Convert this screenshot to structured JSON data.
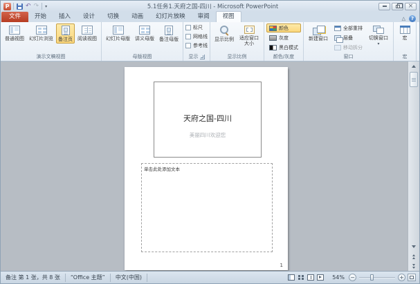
{
  "colors": {
    "highlight_fill": "#fbd77d",
    "highlight_border": "#c79f42",
    "file_tab": "#b63c22",
    "doc_background": "#b7bdc4"
  },
  "icons": {
    "app_letter": "P",
    "undo": "↶",
    "redo": "↷",
    "dropdown": "▾",
    "close": "×",
    "collapse_ribbon": "△",
    "help": "?",
    "minus": "−",
    "plus": "+"
  },
  "titlebar": {
    "title": "5.1任务1.天府之国-四川 - Microsoft PowerPoint"
  },
  "tabs": [
    {
      "label": "文件"
    },
    {
      "label": "开始"
    },
    {
      "label": "插入"
    },
    {
      "label": "设计"
    },
    {
      "label": "切换"
    },
    {
      "label": "动画"
    },
    {
      "label": "幻灯片放映"
    },
    {
      "label": "审阅"
    },
    {
      "label": "视图"
    }
  ],
  "ribbon": {
    "views": {
      "label": "演示文稿视图",
      "buttons": [
        {
          "label": "普通视图"
        },
        {
          "label": "幻灯片浏览"
        },
        {
          "label": "备注页"
        },
        {
          "label": "阅读视图"
        }
      ]
    },
    "master": {
      "label": "母版视图",
      "buttons": [
        {
          "label": "幻灯片母版"
        },
        {
          "label": "讲义母版"
        },
        {
          "label": "备注母版"
        }
      ]
    },
    "show": {
      "label": "显示",
      "checkboxes": [
        {
          "label": "标尺"
        },
        {
          "label": "网格线"
        },
        {
          "label": "参考线"
        }
      ]
    },
    "zoom": {
      "label": "显示比例",
      "buttons": [
        {
          "label": "显示比例"
        },
        {
          "label": "适应窗口大小"
        }
      ]
    },
    "color": {
      "label": "颜色/灰度",
      "buttons": [
        {
          "label": "颜色"
        },
        {
          "label": "灰度"
        },
        {
          "label": "黑白模式"
        }
      ]
    },
    "window": {
      "label": "窗口",
      "new_window": "新建窗口",
      "smalls": [
        {
          "label": "全部重排"
        },
        {
          "label": "层叠"
        },
        {
          "label": "移动拆分"
        }
      ],
      "switch_window": "切换窗口"
    },
    "macro": {
      "label": "宏",
      "button": "宏"
    }
  },
  "document": {
    "slide_title": "天府之国-四川",
    "slide_subtitle": "美丽四川欢迎您",
    "notes_placeholder": "单击此处添加文本",
    "page_number": "1"
  },
  "statusbar": {
    "notes_info": "备注 第 1 张，共 8 张",
    "theme": "“Office 主题”",
    "language": "中文(中国)",
    "zoom_level": "54%"
  }
}
